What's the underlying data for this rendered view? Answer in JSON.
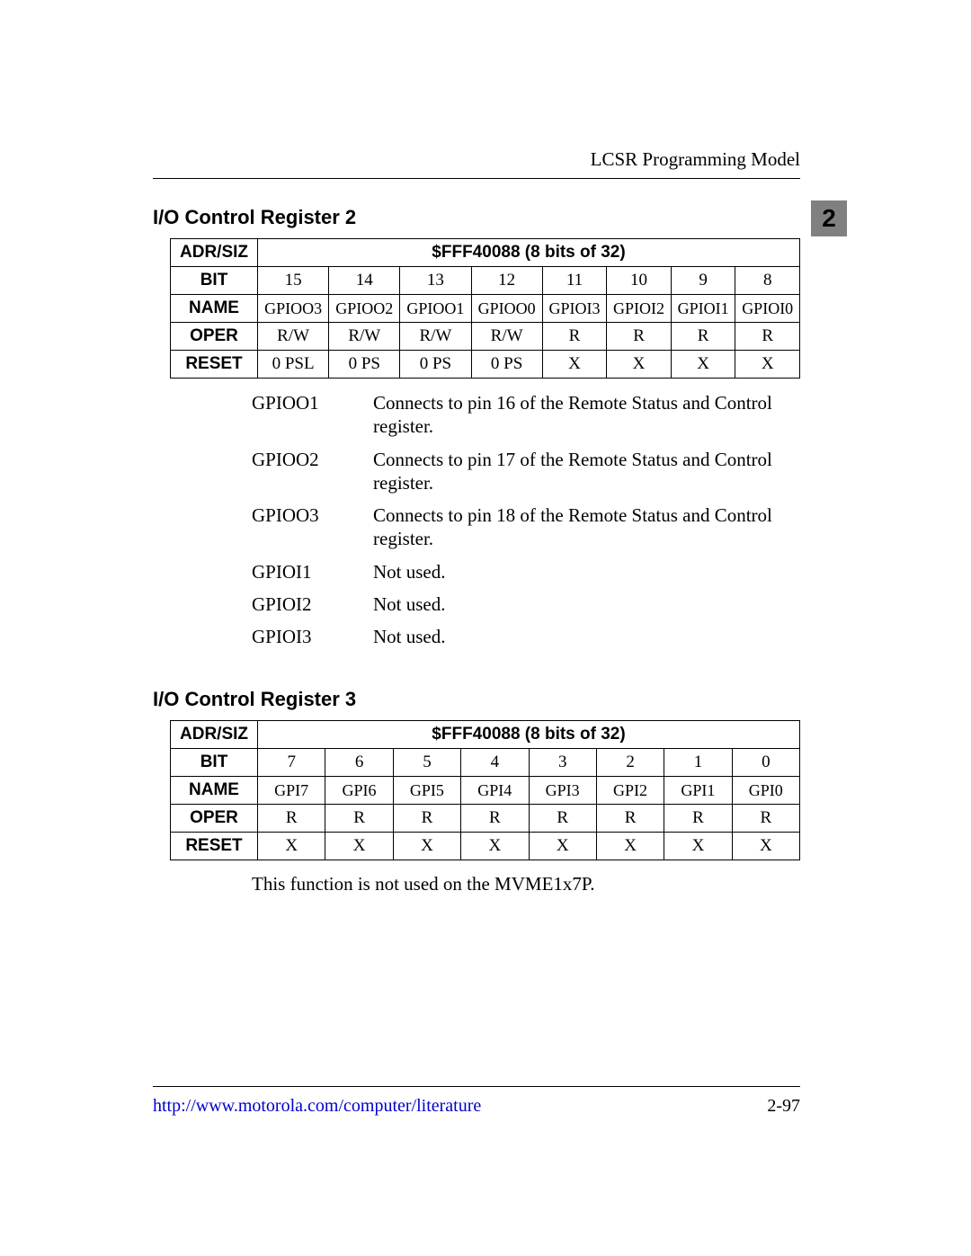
{
  "header": {
    "running_title": "LCSR Programming Model",
    "chapter_num": "2"
  },
  "sec2": {
    "title": "I/O Control Register 2",
    "adr_label": "ADR/SIZ",
    "adr_value": "$FFF40088 (8 bits of 32)",
    "bit_label": "BIT",
    "bits": [
      "15",
      "14",
      "13",
      "12",
      "11",
      "10",
      "9",
      "8"
    ],
    "name_label": "NAME",
    "names": [
      "GPIOO3",
      "GPIOO2",
      "GPIOO1",
      "GPIOO0",
      "GPIOI3",
      "GPIOI2",
      "GPIOI1",
      "GPIOI0"
    ],
    "oper_label": "OPER",
    "oper": [
      "R/W",
      "R/W",
      "R/W",
      "R/W",
      "R",
      "R",
      "R",
      "R"
    ],
    "reset_label": "RESET",
    "reset": [
      "0 PSL",
      "0 PS",
      "0 PS",
      "0 PS",
      "X",
      "X",
      "X",
      "X"
    ],
    "desc": [
      {
        "term": "GPIOO1",
        "def": "Connects to pin 16 of the Remote Status and Control register."
      },
      {
        "term": "GPIOO2",
        "def": "Connects to pin 17 of the Remote Status and Control register."
      },
      {
        "term": "GPIOO3",
        "def": "Connects to pin 18 of the Remote Status and Control register."
      },
      {
        "term": "GPIOI1",
        "def": "Not used."
      },
      {
        "term": "GPIOI2",
        "def": "Not used."
      },
      {
        "term": "GPIOI3",
        "def": "Not used."
      }
    ]
  },
  "sec3": {
    "title": "I/O Control Register 3",
    "adr_label": "ADR/SIZ",
    "adr_value": "$FFF40088 (8 bits of 32)",
    "bit_label": "BIT",
    "bits": [
      "7",
      "6",
      "5",
      "4",
      "3",
      "2",
      "1",
      "0"
    ],
    "name_label": "NAME",
    "names": [
      "GPI7",
      "GPI6",
      "GPI5",
      "GPI4",
      "GPI3",
      "GPI2",
      "GPI1",
      "GPI0"
    ],
    "oper_label": "OPER",
    "oper": [
      "R",
      "R",
      "R",
      "R",
      "R",
      "R",
      "R",
      "R"
    ],
    "reset_label": "RESET",
    "reset": [
      "X",
      "X",
      "X",
      "X",
      "X",
      "X",
      "X",
      "X"
    ],
    "caption": "This function is not used on the MVME1x7P."
  },
  "footer": {
    "url": "http://www.motorola.com/computer/literature",
    "page": "2-97"
  }
}
